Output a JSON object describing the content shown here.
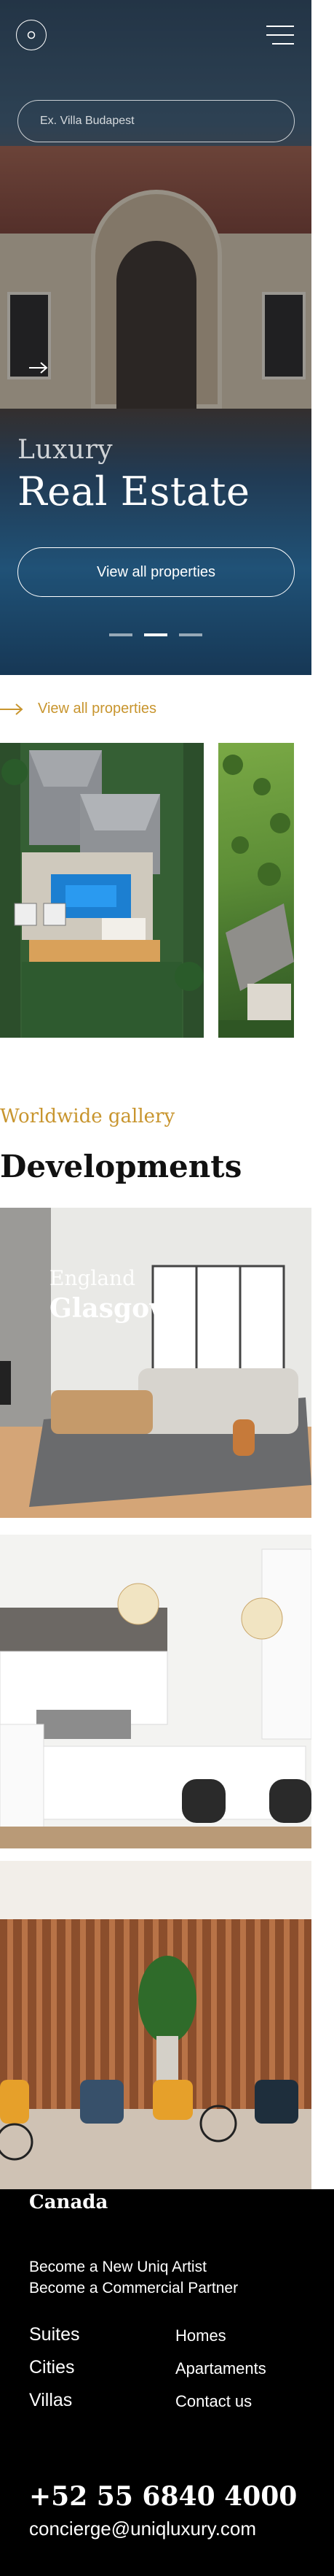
{
  "hero": {
    "search_placeholder": "Ex. Villa Budapest",
    "subtitle": "Luxury",
    "title": "Real Estate",
    "cta_label": "View all properties",
    "carousel_active_index": 1,
    "carousel_count": 3
  },
  "properties": {
    "view_all_label": "View all properties"
  },
  "developments": {
    "subtitle": "Worldwide gallery",
    "title": "Developments",
    "featured": {
      "country": "England",
      "city": "Glasgow"
    }
  },
  "footer": {
    "country": "Canada",
    "cta_artist": "Become a New Uniq Artist",
    "cta_partner": "Become a Commercial Partner",
    "links_left": [
      "Suites",
      "Cities",
      "Villas"
    ],
    "links_right": [
      "Homes",
      "Apartaments",
      "Contact us"
    ],
    "phone": "+52 55 6840 4000",
    "email": "concierge@uniqluxury.com"
  },
  "colors": {
    "accent_gold": "#c8952e",
    "footer_bg": "#000000"
  },
  "icons": {
    "hero_circle": "circle-icon",
    "menu": "hamburger-menu-icon",
    "arrow": "arrow-right-icon"
  }
}
